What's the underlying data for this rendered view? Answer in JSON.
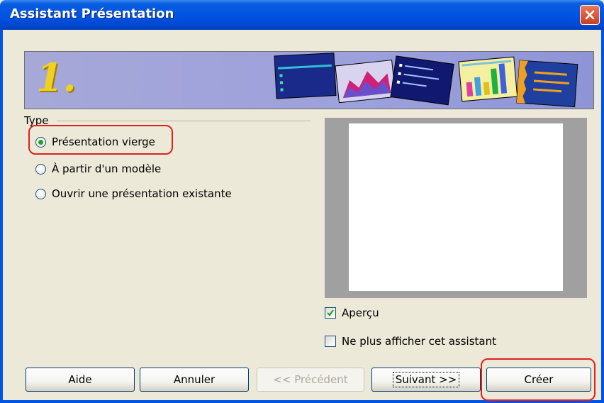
{
  "window": {
    "title": "Assistant Présentation"
  },
  "banner": {
    "step_number": "1."
  },
  "type_group": {
    "legend": "Type",
    "options": [
      {
        "label": "Présentation vierge",
        "selected": true
      },
      {
        "label": "À partir d'un modèle",
        "selected": false
      },
      {
        "label": "Ouvrir une présentation existante",
        "selected": false
      }
    ]
  },
  "preview": {
    "checkbox_label": "Aperçu",
    "checked": true
  },
  "dont_show": {
    "checkbox_label": "Ne plus afficher cet assistant",
    "checked": false
  },
  "buttons": {
    "help": "Aide",
    "cancel": "Annuler",
    "previous": "<< Précédent",
    "next": "Suivant >>",
    "create": "Créer"
  },
  "colors": {
    "titlebar": "#0054e3",
    "highlight": "#e02020",
    "radio_dot": "#21a121"
  },
  "icons": [
    "close-icon",
    "banner-slides-illustration",
    "checkmark-icon"
  ]
}
